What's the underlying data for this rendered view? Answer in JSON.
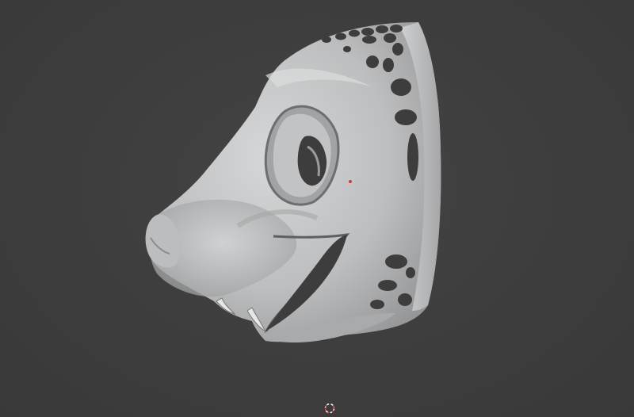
{
  "viewport": {
    "background_color": "#3d3d3d",
    "model_color": "#c9cacb",
    "origin_color": "#d23b3b",
    "cursor_colors": [
      "#e04040",
      "#ffffff"
    ]
  },
  "icons": {
    "cursor": "3d-cursor-icon",
    "origin": "object-origin-icon"
  }
}
